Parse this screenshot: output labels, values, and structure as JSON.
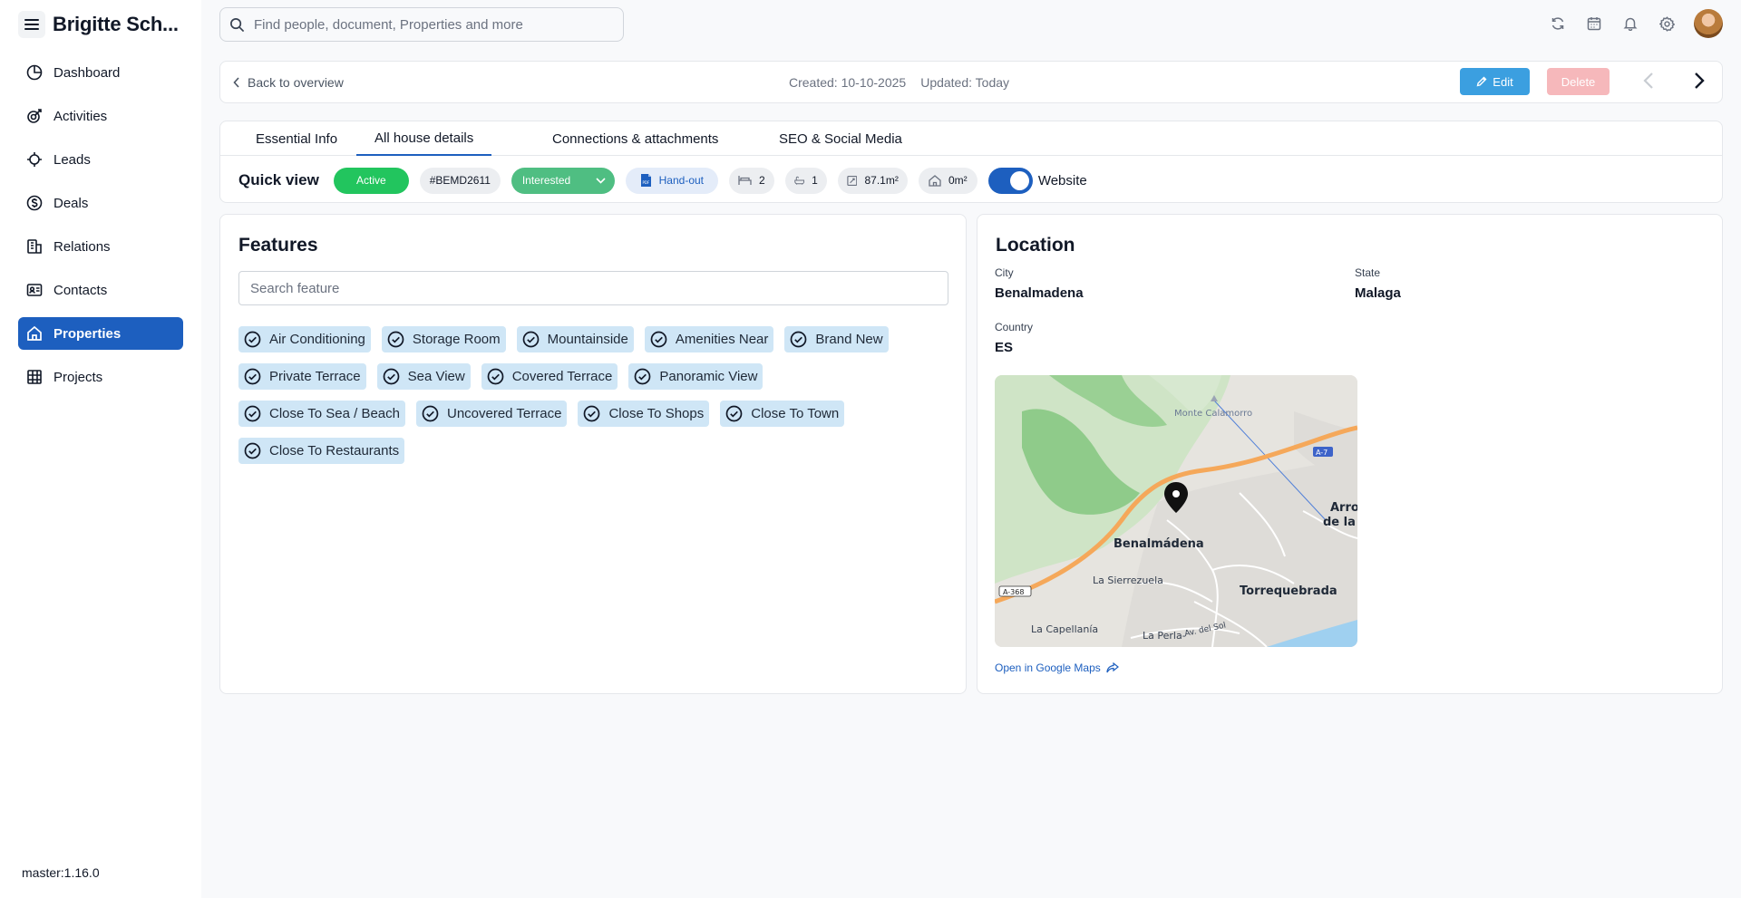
{
  "app": {
    "user_name": "Brigitte Sch...",
    "version": "master:1.16.0"
  },
  "search": {
    "placeholder": "Find people, document, Properties and more"
  },
  "sidebar": {
    "items": [
      {
        "label": "Dashboard",
        "icon": "dashboard-icon"
      },
      {
        "label": "Activities",
        "icon": "activities-icon"
      },
      {
        "label": "Leads",
        "icon": "leads-icon"
      },
      {
        "label": "Deals",
        "icon": "deals-icon"
      },
      {
        "label": "Relations",
        "icon": "relations-icon"
      },
      {
        "label": "Contacts",
        "icon": "contacts-icon"
      },
      {
        "label": "Properties",
        "icon": "home-icon",
        "active": true
      },
      {
        "label": "Projects",
        "icon": "projects-icon"
      }
    ]
  },
  "topbar": {
    "back_label": "Back to overview",
    "created": "Created: 10-10-2025",
    "updated": "Updated: Today",
    "edit_label": "Edit",
    "delete_label": "Delete"
  },
  "tabs": [
    {
      "label": "Essential Info"
    },
    {
      "label": "All house details",
      "active": true
    },
    {
      "label": "Connections & attachments"
    },
    {
      "label": "SEO & Social Media"
    }
  ],
  "quick_view": {
    "label": "Quick view",
    "status": "Active",
    "reference": "#BEMD2611",
    "interest": "Interested",
    "handout": "Hand-out",
    "bedrooms": "2",
    "bathrooms": "1",
    "built_area": "87.1m²",
    "plot_area": "0m²",
    "website_label": "Website",
    "website_enabled": true
  },
  "features": {
    "title": "Features",
    "search_placeholder": "Search feature",
    "rows": [
      [
        "Air Conditioning",
        "Storage Room",
        "Mountainside",
        "Amenities Near",
        "Brand New"
      ],
      [
        "Private Terrace",
        "Sea View",
        "Covered Terrace",
        "Panoramic View"
      ],
      [
        "Close To Sea / Beach",
        "Uncovered Terrace",
        "Close To Shops",
        "Close To Town"
      ],
      [
        "Close To Restaurants"
      ]
    ]
  },
  "location": {
    "title": "Location",
    "city_label": "City",
    "city": "Benalmadena",
    "state_label": "State",
    "state": "Malaga",
    "country_label": "Country",
    "country": "ES",
    "map_labels": {
      "peak": "Monte Calamorro",
      "highway_a7": "A-7",
      "highway_a368": "A-368",
      "town": "Benalmádena",
      "area1": "La Sierrezuela",
      "area2": "Torrequebrada",
      "area3": "La Capellanía",
      "area4": "La Perla-",
      "road": "Av. del Sol",
      "edge1": "Arro",
      "edge2": "de la l"
    },
    "maps_link": "Open in Google Maps"
  },
  "colors": {
    "primary": "#1d5fbf",
    "active_green": "#22c55e",
    "interested_green": "#4fbe82",
    "edit_blue": "#3b9fe0",
    "delete_pink": "#f6b8bb",
    "chip_blue": "#cfe6f6"
  }
}
